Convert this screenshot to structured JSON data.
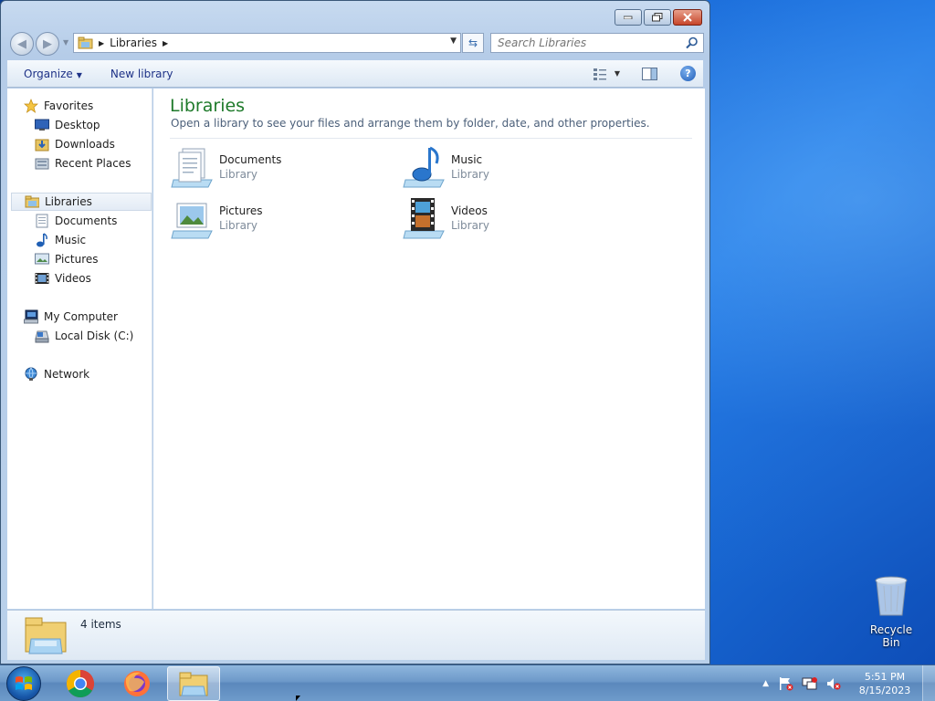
{
  "window": {
    "address": {
      "crumb": "Libraries"
    },
    "search": {
      "placeholder": "Search Libraries"
    },
    "toolbar": {
      "organize": "Organize",
      "new_library": "New library"
    }
  },
  "nav_pane": {
    "favorites": {
      "label": "Favorites",
      "items": [
        {
          "label": "Desktop"
        },
        {
          "label": "Downloads"
        },
        {
          "label": "Recent Places"
        }
      ]
    },
    "libraries": {
      "label": "Libraries",
      "selected": true,
      "items": [
        {
          "label": "Documents"
        },
        {
          "label": "Music"
        },
        {
          "label": "Pictures"
        },
        {
          "label": "Videos"
        }
      ]
    },
    "computer": {
      "label": "My Computer",
      "items": [
        {
          "label": "Local Disk (C:)"
        }
      ]
    },
    "network": {
      "label": "Network"
    }
  },
  "content": {
    "title": "Libraries",
    "description": "Open a library to see your files and arrange them by folder, date, and other properties.",
    "items": [
      {
        "name": "Documents",
        "type": "Library",
        "icon": "documents-library-icon"
      },
      {
        "name": "Music",
        "type": "Library",
        "icon": "music-library-icon"
      },
      {
        "name": "Pictures",
        "type": "Library",
        "icon": "pictures-library-icon"
      },
      {
        "name": "Videos",
        "type": "Library",
        "icon": "videos-library-icon"
      }
    ]
  },
  "status_bar": {
    "count": "4 items"
  },
  "desktop": {
    "recycle_bin": "Recycle Bin"
  },
  "taskbar": {
    "apps": [
      {
        "name": "chrome-icon"
      },
      {
        "name": "firefox-icon"
      },
      {
        "name": "explorer-icon",
        "active": true
      }
    ],
    "clock": {
      "time": "5:51 PM",
      "date": "8/15/2023"
    }
  },
  "colors": {
    "title_green": "#1e7a2a",
    "link_blue": "#1e3287",
    "desktop_blue": "#1266d6"
  }
}
